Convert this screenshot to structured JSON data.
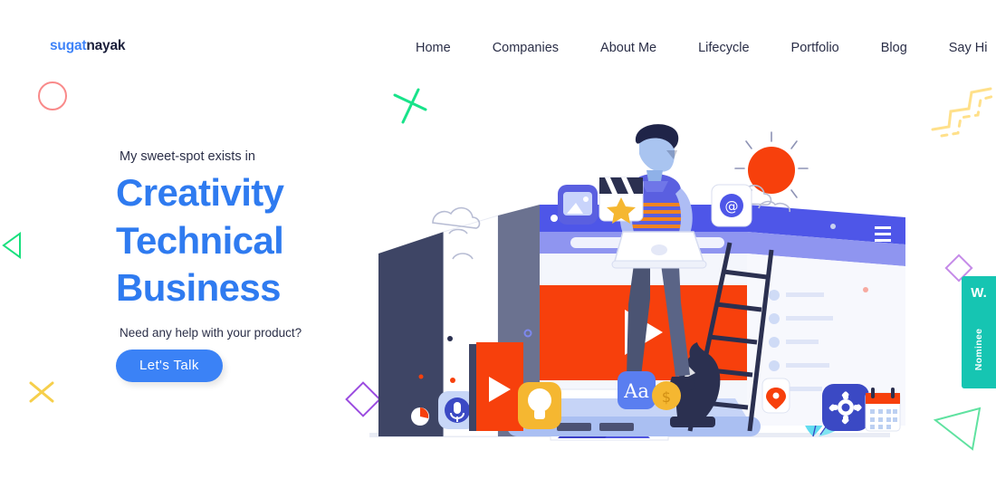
{
  "brand": {
    "logo_primary": "sugat",
    "logo_secondary": "nayak",
    "accent_blue": "#3b82f6",
    "headline_blue": "#2f7bf0",
    "dark_navy": "#2b2f48",
    "teal": "#16c5b2",
    "orange": "#fa3c00"
  },
  "nav": {
    "items": [
      {
        "label": "Home"
      },
      {
        "label": "Companies"
      },
      {
        "label": "About Me"
      },
      {
        "label": "Lifecycle"
      },
      {
        "label": "Portfolio"
      },
      {
        "label": "Blog"
      },
      {
        "label": "Say Hi"
      }
    ]
  },
  "hero": {
    "eyebrow": "My sweet-spot exists in",
    "headline_lines": [
      "Creativity",
      "Technical",
      "Business"
    ],
    "subtext": "Need any help with your product?",
    "cta_label": "Let's Talk"
  },
  "side_badge": {
    "top_label": "W.",
    "rotated_label": "Nominee"
  },
  "decor": {
    "circle": "pink-circle-outline",
    "triangle_left": "green-triangle-outline",
    "x_yellow": "yellow-x-mark",
    "x_green": "green-x-mark",
    "zigzag": "yellow-zigzag-line",
    "diamond_right": "purple-diamond-outline",
    "diamond_mid": "purple-diamond-outline",
    "triangle_right": "green-triangle-outline"
  },
  "illustration": {
    "name": "person-sitting-on-browser-window-with-laptop",
    "elements": [
      "browser-window",
      "video-player-play-button",
      "seated-person",
      "laptop",
      "ladder",
      "sun",
      "clouds",
      "photo-icon",
      "clapperboard-star-icon",
      "email-at-icon",
      "microphone-icon",
      "lightbulb-icon",
      "pie-chart-icon",
      "typography-aa-icon",
      "coin-icon",
      "gear-icon",
      "calendar-icon",
      "location-pin-icon",
      "chess-knight-icon",
      "image-placeholder",
      "leaf-shapes"
    ]
  }
}
